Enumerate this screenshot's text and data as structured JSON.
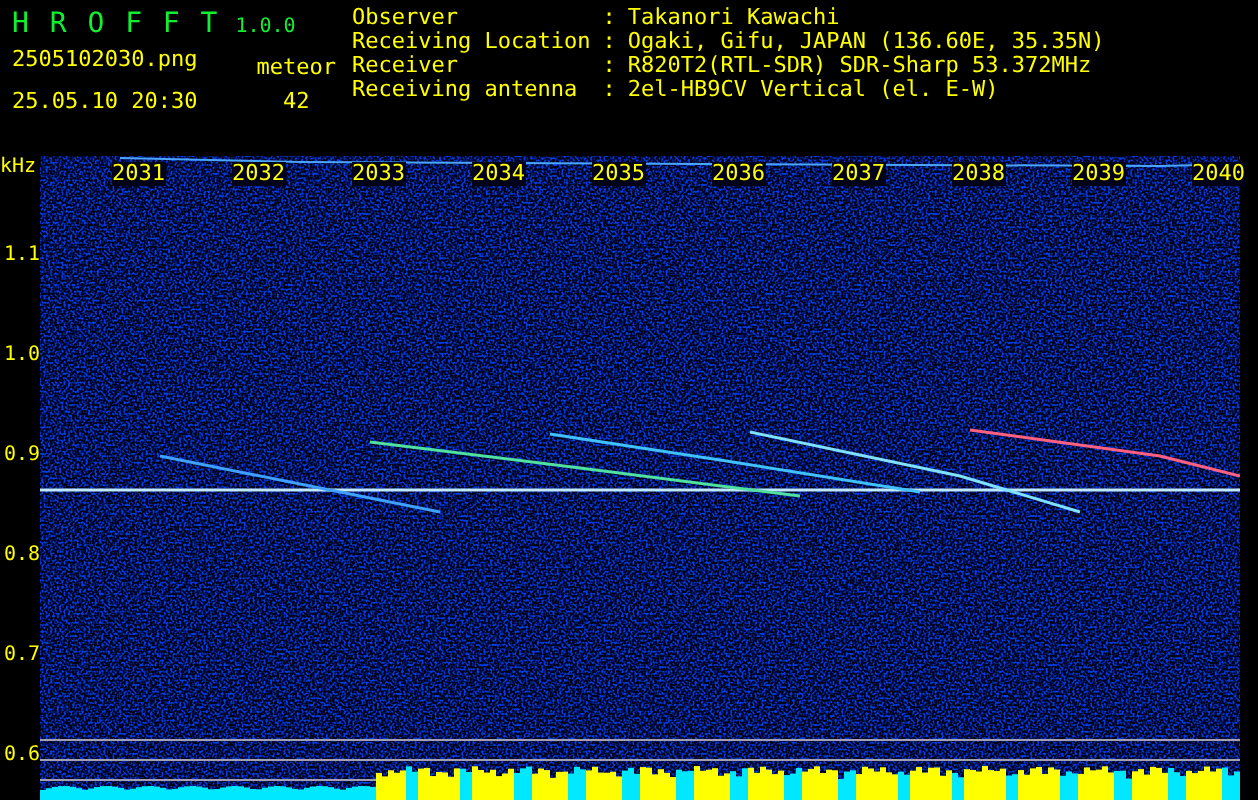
{
  "header": {
    "title": "H R O F F T",
    "version": "1.0.0",
    "filename": "2505102030.png",
    "datetime": "25.05.10 20:30",
    "count_label": "meteor",
    "count": "42"
  },
  "info": [
    {
      "label": "Observer",
      "separator": ":",
      "value": "Takanori Kawachi"
    },
    {
      "label": "Receiving Location",
      "separator": ":",
      "value": "Ogaki, Gifu, JAPAN (136.60E, 35.35N)"
    },
    {
      "label": "Receiver",
      "separator": ":",
      "value": "R820T2(RTL-SDR) SDR-Sharp 53.372MHz"
    },
    {
      "label": "Receiving antenna",
      "separator": ":",
      "value": "2el-HB9CV Vertical (el. E-W)"
    }
  ],
  "spectrogram": {
    "unit": "kHz",
    "time_labels": [
      "2031",
      "2032",
      "2033",
      "2034",
      "2035",
      "2036",
      "2037",
      "2038",
      "2039",
      "2040"
    ],
    "freq_labels": [
      "1.1",
      "1.0",
      "0.9",
      "0.8",
      "0.7",
      "0.6"
    ]
  }
}
